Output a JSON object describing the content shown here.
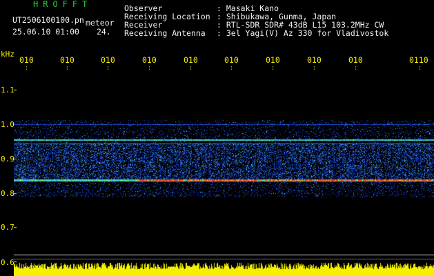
{
  "app": {
    "title": "HROFFT"
  },
  "session": {
    "file": "UT2506100100.pn",
    "mode": "meteor",
    "datetime": "25.06.10 01:00",
    "frame": "24."
  },
  "info": [
    {
      "key": "Observer",
      "value": ": Masaki Kano"
    },
    {
      "key": "Receiving Location",
      "value": ": Shibukawa, Gunma, Japan"
    },
    {
      "key": "Receiver",
      "value": ": RTL-SDR SDR# 43dB L15 103.2MHz CW"
    },
    {
      "key": "Receiving Antenna",
      "value": ": 3el Yagi(V) Az 330 for Vladivostok"
    }
  ],
  "axis": {
    "unit": "kHz",
    "x_ticks": [
      "010",
      "010",
      "010",
      "010",
      "010",
      "010",
      "010",
      "010",
      "010",
      "0110"
    ],
    "y_ticks": [
      "1.1",
      "1.0",
      "0.9",
      "0.8",
      "0.7",
      "0.6"
    ]
  },
  "colors": {
    "label": "#f4f000",
    "title": "#27d63a",
    "text": "#f2f2f2",
    "background": "#000000"
  }
}
